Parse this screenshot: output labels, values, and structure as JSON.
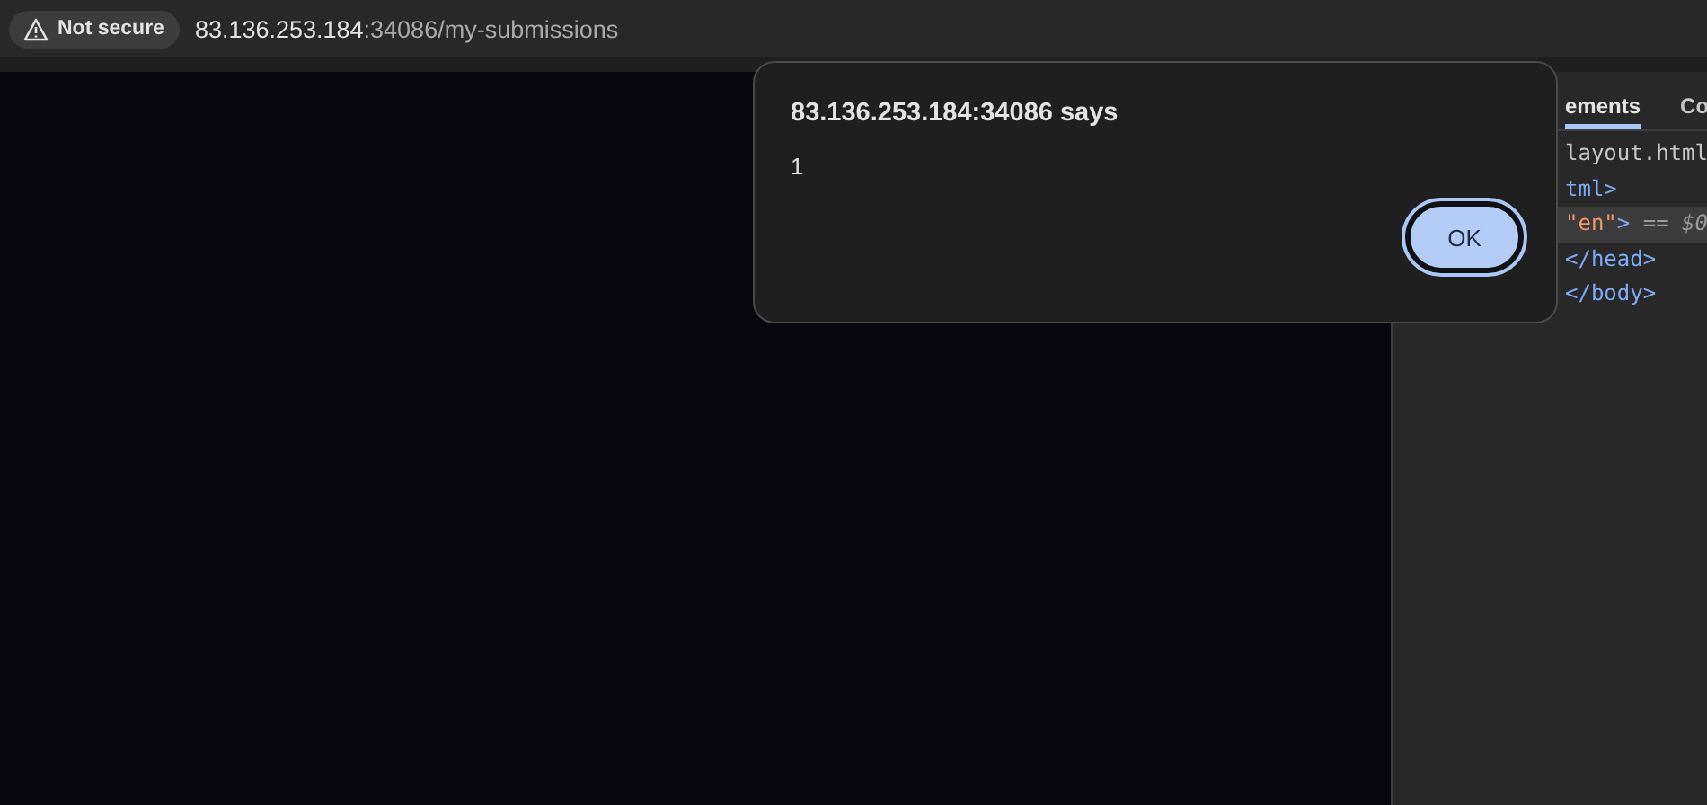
{
  "address_bar": {
    "security_label": "Not secure",
    "url_host": "83.136.253.184",
    "url_rest": ":34086/my-submissions"
  },
  "devtools": {
    "tabs": [
      {
        "label": "ements",
        "selected": true
      },
      {
        "label": "Co",
        "selected": false
      }
    ],
    "lines": [
      {
        "selected": false,
        "parts": [
          {
            "kind": "plain",
            "text": "layout.html"
          }
        ]
      },
      {
        "selected": false,
        "parts": [
          {
            "kind": "tag",
            "text": "tml>"
          }
        ]
      },
      {
        "selected": true,
        "parts": [
          {
            "kind": "value",
            "text": "\"en\""
          },
          {
            "kind": "tag",
            "text": ">"
          },
          {
            "kind": "note",
            "text": " == $0"
          }
        ]
      },
      {
        "selected": false,
        "parts": [
          {
            "kind": "tag",
            "text": "</head>"
          }
        ]
      },
      {
        "selected": false,
        "parts": [
          {
            "kind": "tag",
            "text": "</body>"
          }
        ]
      }
    ]
  },
  "dialog": {
    "title": "83.136.253.184:34086 says",
    "message": "1",
    "button": "OK"
  }
}
